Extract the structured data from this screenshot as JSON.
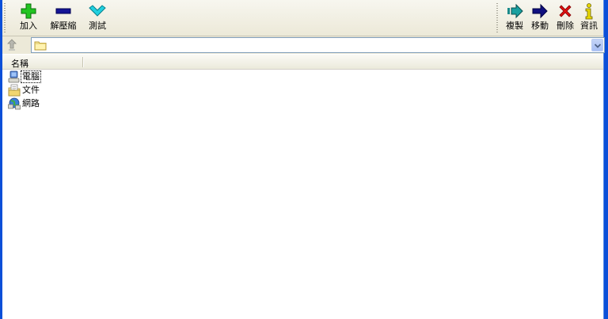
{
  "toolbar": {
    "left_buttons": [
      {
        "label": "加入",
        "icon": "plus-icon"
      },
      {
        "label": "解壓縮",
        "icon": "minus-icon"
      },
      {
        "label": "測試",
        "icon": "check-icon"
      }
    ],
    "right_buttons": [
      {
        "label": "複製",
        "icon": "copy-arrow-icon"
      },
      {
        "label": "移動",
        "icon": "move-arrow-icon"
      },
      {
        "label": "刪除",
        "icon": "delete-x-icon"
      },
      {
        "label": "資訊",
        "icon": "info-icon"
      }
    ]
  },
  "address_bar": {
    "value": ""
  },
  "columns": {
    "name_header": "名稱"
  },
  "items": [
    {
      "label": "電腦",
      "icon": "computer-icon",
      "focused": true
    },
    {
      "label": "文件",
      "icon": "documents-icon",
      "focused": false
    },
    {
      "label": "網路",
      "icon": "network-icon",
      "focused": false
    }
  ],
  "colors": {
    "frame": "#0b4fd8",
    "toolbar_bg": "#ece9d8",
    "plus": "#1fbf1f",
    "minus": "#101098",
    "check": "#18c8d8",
    "delete": "#e01010",
    "info": "#e8d800"
  }
}
